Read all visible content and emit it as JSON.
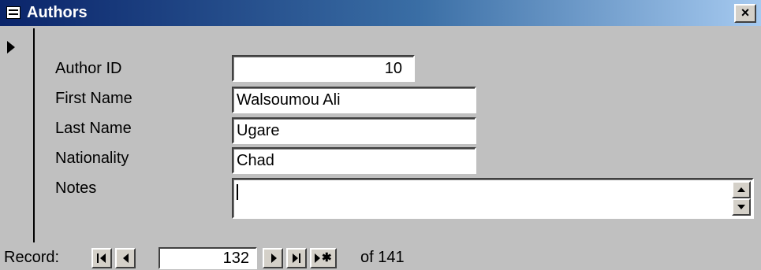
{
  "window": {
    "title": "Authors",
    "close_symbol": "×"
  },
  "form": {
    "fields": [
      {
        "label": "Author ID",
        "value": "10"
      },
      {
        "label": "First Name",
        "value": "Walsoumou Ali"
      },
      {
        "label": "Last Name",
        "value": "Ugare"
      },
      {
        "label": "Nationality",
        "value": "Chad"
      },
      {
        "label": "Notes",
        "value": ""
      }
    ]
  },
  "navigation": {
    "label": "Record:",
    "current": "132",
    "of_text": "of 141"
  }
}
